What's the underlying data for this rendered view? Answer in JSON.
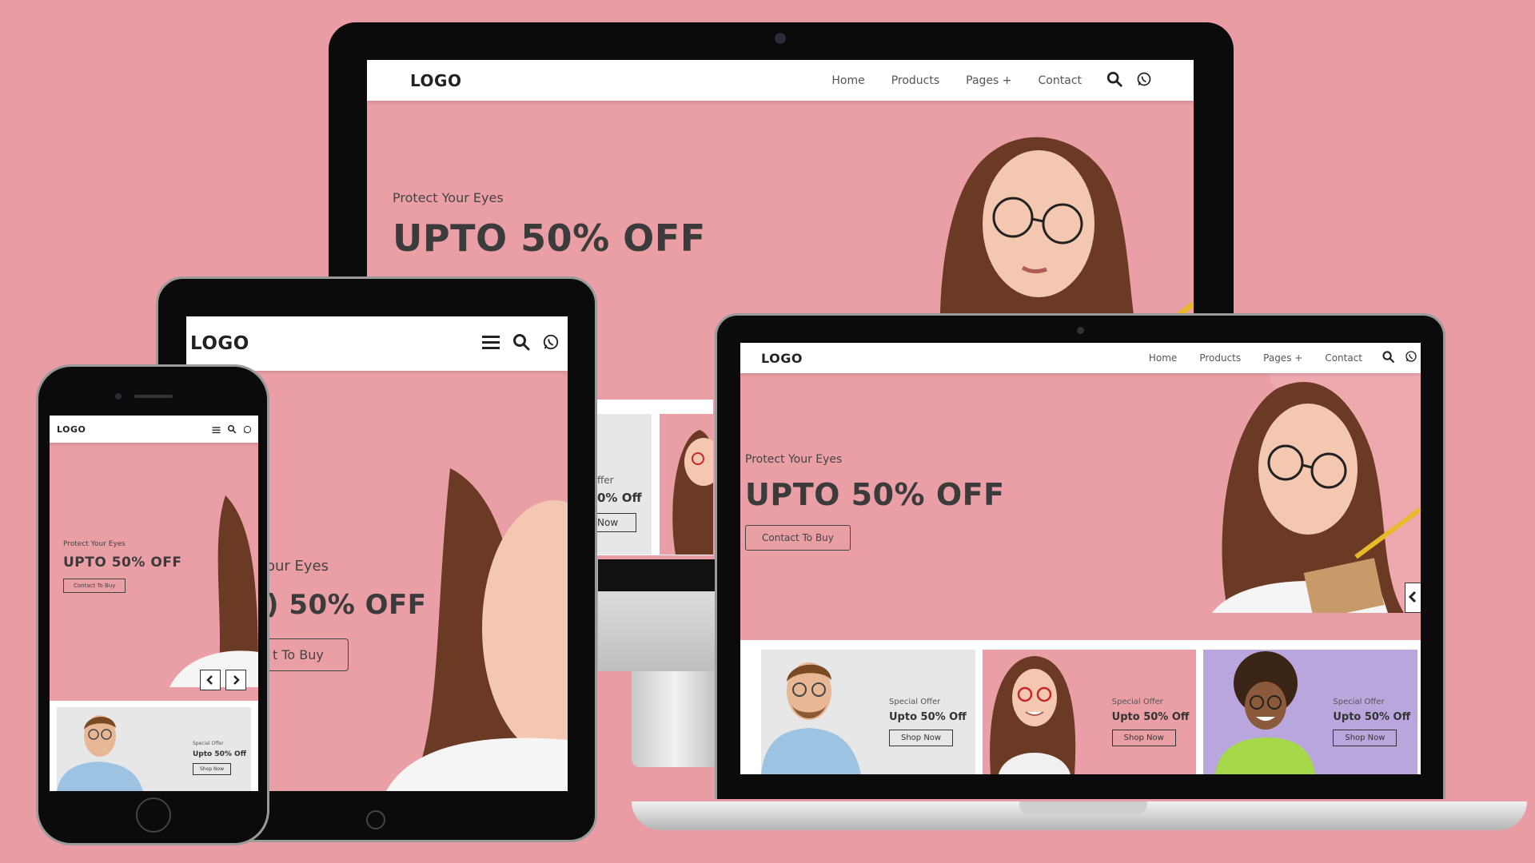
{
  "site": {
    "logo": "LOGO",
    "nav": [
      "Home",
      "Products",
      "Pages +",
      "Contact"
    ],
    "kicker": "Protect Your Eyes",
    "headline": "UPTO 50% OFF",
    "cta": "Contact To Buy",
    "partial_kicker_tablet": "our Eyes",
    "partial_headline_tablet": ") 50% OFF",
    "partial_cta_tablet": "t To Buy",
    "partial_offer_1": "ffer",
    "partial_offer_2": "0% Off",
    "partial_offer_3": "Now"
  },
  "cards": [
    {
      "kicker": "Special Offer",
      "title": "Upto 50% Off",
      "button": "Shop Now",
      "bg": "#e7e7e7"
    },
    {
      "kicker": "Special Offer",
      "title": "Upto 50% Off",
      "button": "Shop Now",
      "bg": "#ea9ea5"
    },
    {
      "kicker": "Special Offer",
      "title": "Upto 50% Off",
      "button": "Shop Now",
      "bg": "#b9a6dd"
    }
  ],
  "icons": [
    "search-icon",
    "whatsapp-icon",
    "menu-icon",
    "chevron-left-icon",
    "chevron-right-icon"
  ],
  "colors": {
    "background": "#e99ca3",
    "hero": "#ea9ea5",
    "text": "#3b3b3b",
    "device": "#0b0b0b"
  }
}
